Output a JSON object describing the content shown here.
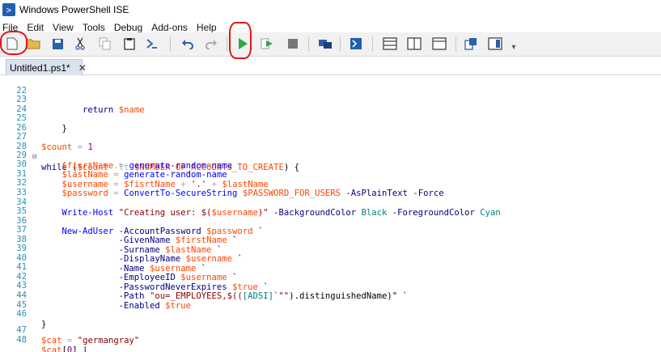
{
  "window": {
    "title": "Windows PowerShell ISE"
  },
  "menu": [
    "File",
    "Edit",
    "View",
    "Tools",
    "Debug",
    "Add-ons",
    "Help"
  ],
  "toolbar": {
    "icons": [
      "new-icon",
      "open-icon",
      "save-icon",
      "cut-icon",
      "copy-icon",
      "paste-icon",
      "clear-console-icon",
      "undo-icon",
      "redo-icon",
      "run-icon",
      "run-selection-icon",
      "stop-icon",
      "remote-powershell-icon",
      "powershell-console-icon",
      "script-pane-top-icon",
      "script-pane-right-icon",
      "script-pane-maximized-icon",
      "show-commands-window-icon",
      "show-command-addon-icon"
    ]
  },
  "tab": {
    "label": "Untitled1.ps1*",
    "close": "✕"
  },
  "editor": {
    "lines": [
      {
        "n": "22",
        "text": ""
      },
      {
        "n": "23",
        "text": "        return $name"
      },
      {
        "n": "24",
        "text": ""
      },
      {
        "n": "25",
        "text": "    }"
      },
      {
        "n": "26",
        "text": ""
      },
      {
        "n": "27",
        "text": "$count = 1"
      },
      {
        "n": "28",
        "text": "while ($count -lt $NUMBER_OF_ACCOUNTS_TO_CREATE) {"
      },
      {
        "n": "29",
        "text": "    $fisrtName = generate-random-name"
      },
      {
        "n": "30",
        "text": "    $lastName = generate-random-name"
      },
      {
        "n": "31",
        "text": "    $username = $fisrtName + '.' + $lastName"
      },
      {
        "n": "32",
        "text": "    $password = ConvertTo-SecureString $PASSWORD_FOR_USERS -AsPlainText -Force"
      },
      {
        "n": "33",
        "text": ""
      },
      {
        "n": "34",
        "text": "    Write-Host \"Creating user: $($username)\" -BackgroundColor Black -ForegroundColor Cyan"
      },
      {
        "n": "35",
        "text": ""
      },
      {
        "n": "36",
        "text": "    New-AdUser -AccountPassword $password `"
      },
      {
        "n": "37",
        "text": "               -GivenName $firstName `"
      },
      {
        "n": "38",
        "text": "               -Surname $lastName `"
      },
      {
        "n": "39",
        "text": "               -DisplayName $username `"
      },
      {
        "n": "40",
        "text": "               -Name $username `"
      },
      {
        "n": "41",
        "text": "               -EmployeeID $username `"
      },
      {
        "n": "42",
        "text": "               -PasswordNeverExpires $true `"
      },
      {
        "n": "43",
        "text": "               -Path \"ou=_EMPLOYEES,$(([ADSI]`\"\").distinguishedName)\" `"
      },
      {
        "n": "44",
        "text": "               -Enabled $true"
      },
      {
        "n": "45",
        "text": ""
      },
      {
        "n": "46",
        "text": "}"
      },
      {
        "n": "47",
        "text": "$cat = \"germangray\""
      },
      {
        "n": "48",
        "text": "$cat[0] |"
      }
    ]
  },
  "colors": {
    "variable": "#ff4500",
    "keyword": "#00008b",
    "command": "#0000ff",
    "string": "#8b0000",
    "parameter": "#000080",
    "line_number": "#2b91af",
    "annotation": "#e8121b"
  }
}
